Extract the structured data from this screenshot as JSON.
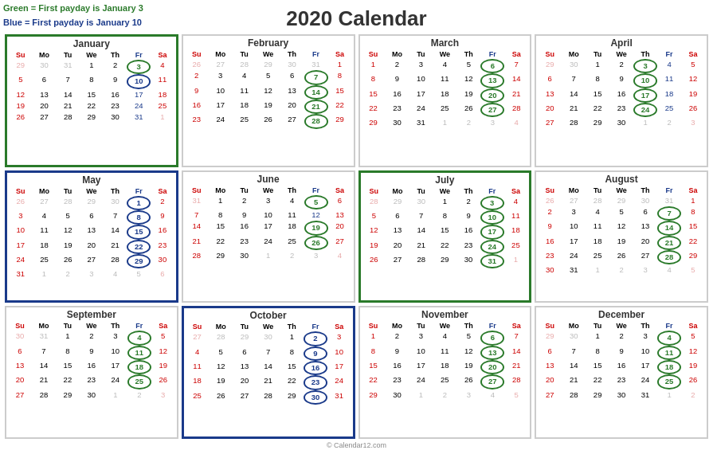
{
  "title": "2020 Calendar",
  "legend": {
    "green_text": "Green = First payday is January 3",
    "blue_text": "Blue = First payday is January 10"
  },
  "copyright": "© Calendar12.com",
  "day_headers": [
    "Su",
    "Mo",
    "Tu",
    "We",
    "Th",
    "Fr",
    "Sa"
  ],
  "months": [
    {
      "name": "January",
      "border": "green",
      "weeks": [
        [
          "29",
          "30",
          "31",
          "1",
          "2",
          "3",
          "4"
        ],
        [
          "5",
          "6",
          "7",
          "8",
          "9",
          "10",
          "11"
        ],
        [
          "12",
          "13",
          "14",
          "15",
          "16",
          "17",
          "18"
        ],
        [
          "19",
          "20",
          "21",
          "22",
          "23",
          "24",
          "25"
        ],
        [
          "26",
          "27",
          "28",
          "29",
          "30",
          "31",
          "1"
        ]
      ],
      "other_start": [
        0,
        1,
        2
      ],
      "other_end": [
        6
      ],
      "circled_green": [
        "3"
      ],
      "circled_blue": [
        "10"
      ],
      "highlighted_green": [
        "17",
        "24",
        "31"
      ]
    },
    {
      "name": "February",
      "border": "none",
      "weeks": [
        [
          "26",
          "27",
          "28",
          "29",
          "30",
          "31",
          "1"
        ],
        [
          "2",
          "3",
          "4",
          "5",
          "6",
          "7",
          "8"
        ],
        [
          "9",
          "10",
          "11",
          "12",
          "13",
          "14",
          "15"
        ],
        [
          "16",
          "17",
          "18",
          "19",
          "20",
          "21",
          "22"
        ],
        [
          "23",
          "24",
          "25",
          "26",
          "27",
          "28",
          "29"
        ]
      ],
      "other_start_w0": [
        0,
        1,
        2,
        3,
        4,
        5
      ],
      "circled_green": [
        "7",
        "14",
        "21",
        "28"
      ],
      "circled_blue": []
    },
    {
      "name": "March",
      "border": "none",
      "weeks": [
        [
          "1",
          "2",
          "3",
          "4",
          "5",
          "6",
          "7"
        ],
        [
          "8",
          "9",
          "10",
          "11",
          "12",
          "13",
          "14"
        ],
        [
          "15",
          "16",
          "17",
          "18",
          "19",
          "20",
          "21"
        ],
        [
          "22",
          "23",
          "24",
          "25",
          "26",
          "27",
          "28"
        ],
        [
          "29",
          "30",
          "31",
          "1",
          "2",
          "3",
          "4"
        ]
      ],
      "other_end_w4": [
        3,
        4,
        5,
        6
      ],
      "circled_green": [
        "6",
        "13",
        "20",
        "27"
      ],
      "circled_blue": []
    },
    {
      "name": "April",
      "border": "none",
      "weeks": [
        [
          "29",
          "30",
          "1",
          "2",
          "3",
          "4",
          "5"
        ],
        [
          "6",
          "7",
          "8",
          "9",
          "10",
          "11",
          "12"
        ],
        [
          "13",
          "14",
          "15",
          "16",
          "17",
          "18",
          "19"
        ],
        [
          "20",
          "21",
          "22",
          "23",
          "24",
          "25",
          "26"
        ],
        [
          "27",
          "28",
          "29",
          "30",
          "1",
          "2",
          "3"
        ]
      ],
      "other_start_w0": [
        0,
        1
      ],
      "other_end_w4": [
        4,
        5,
        6
      ],
      "circled_green": [
        "3",
        "10",
        "17",
        "24"
      ],
      "circled_blue": []
    },
    {
      "name": "May",
      "border": "blue",
      "weeks": [
        [
          "26",
          "27",
          "28",
          "29",
          "30",
          "1",
          "2"
        ],
        [
          "3",
          "4",
          "5",
          "6",
          "7",
          "8",
          "9"
        ],
        [
          "10",
          "11",
          "12",
          "13",
          "14",
          "15",
          "16"
        ],
        [
          "17",
          "18",
          "19",
          "20",
          "21",
          "22",
          "23"
        ],
        [
          "24",
          "25",
          "26",
          "27",
          "28",
          "29",
          "30"
        ],
        [
          "31",
          "1",
          "2",
          "3",
          "4",
          "5",
          "6"
        ]
      ],
      "other_start_w0": [
        0,
        1,
        2,
        3,
        4
      ],
      "other_end_w5": [
        1,
        2,
        3,
        4,
        5,
        6
      ],
      "circled_blue": [
        "1",
        "8",
        "15",
        "22",
        "29"
      ],
      "circled_green": []
    },
    {
      "name": "June",
      "border": "none",
      "weeks": [
        [
          "31",
          "1",
          "2",
          "3",
          "4",
          "5",
          "6"
        ],
        [
          "7",
          "8",
          "9",
          "10",
          "11",
          "12",
          "13"
        ],
        [
          "14",
          "15",
          "16",
          "17",
          "18",
          "19",
          "20"
        ],
        [
          "21",
          "22",
          "23",
          "24",
          "25",
          "26",
          "27"
        ],
        [
          "28",
          "29",
          "30",
          "1",
          "2",
          "3",
          "4"
        ]
      ],
      "other_start_w0": [
        0
      ],
      "other_end_w4": [
        3,
        4,
        5,
        6
      ],
      "circled_green": [
        "5",
        "19",
        "26"
      ],
      "circled_blue": []
    },
    {
      "name": "July",
      "border": "green",
      "weeks": [
        [
          "28",
          "29",
          "30",
          "1",
          "2",
          "3",
          "4"
        ],
        [
          "5",
          "6",
          "7",
          "8",
          "9",
          "10",
          "11"
        ],
        [
          "12",
          "13",
          "14",
          "15",
          "16",
          "17",
          "18"
        ],
        [
          "19",
          "20",
          "21",
          "22",
          "23",
          "24",
          "25"
        ],
        [
          "26",
          "27",
          "28",
          "29",
          "30",
          "31",
          "1"
        ]
      ],
      "other_start_w0": [
        0,
        1,
        2
      ],
      "other_end_w4": [
        6
      ],
      "circled_green": [
        "3",
        "10",
        "17",
        "24",
        "31"
      ],
      "circled_blue": []
    },
    {
      "name": "August",
      "border": "none",
      "weeks": [
        [
          "26",
          "27",
          "28",
          "29",
          "30",
          "31",
          "1"
        ],
        [
          "2",
          "3",
          "4",
          "5",
          "6",
          "7",
          "8"
        ],
        [
          "9",
          "10",
          "11",
          "12",
          "13",
          "14",
          "15"
        ],
        [
          "16",
          "17",
          "18",
          "19",
          "20",
          "21",
          "22"
        ],
        [
          "23",
          "24",
          "25",
          "26",
          "27",
          "28",
          "29"
        ],
        [
          "30",
          "31",
          "1",
          "2",
          "3",
          "4",
          "5"
        ]
      ],
      "other_start_w0": [
        0,
        1,
        2,
        3,
        4,
        5
      ],
      "other_end_w5": [
        2,
        3,
        4,
        5,
        6
      ],
      "circled_green": [
        "7",
        "14",
        "21",
        "28"
      ],
      "circled_blue": []
    },
    {
      "name": "September",
      "border": "none",
      "weeks": [
        [
          "30",
          "31",
          "1",
          "2",
          "3",
          "4",
          "5"
        ],
        [
          "6",
          "7",
          "8",
          "9",
          "10",
          "11",
          "12"
        ],
        [
          "13",
          "14",
          "15",
          "16",
          "17",
          "18",
          "19"
        ],
        [
          "20",
          "21",
          "22",
          "23",
          "24",
          "25",
          "26"
        ],
        [
          "27",
          "28",
          "29",
          "30",
          "1",
          "2",
          "3"
        ]
      ],
      "other_start_w0": [
        0,
        1
      ],
      "other_end_w4": [
        4,
        5,
        6
      ],
      "circled_green": [
        "4",
        "11",
        "18",
        "25"
      ],
      "circled_blue": []
    },
    {
      "name": "October",
      "border": "blue",
      "weeks": [
        [
          "27",
          "28",
          "29",
          "30",
          "1",
          "2",
          "3"
        ],
        [
          "4",
          "5",
          "6",
          "7",
          "8",
          "9",
          "10"
        ],
        [
          "11",
          "12",
          "13",
          "14",
          "15",
          "16",
          "17"
        ],
        [
          "18",
          "19",
          "20",
          "21",
          "22",
          "23",
          "24"
        ],
        [
          "25",
          "26",
          "27",
          "28",
          "29",
          "30",
          "31"
        ]
      ],
      "other_start_w0": [
        0,
        1,
        2,
        3
      ],
      "circled_blue": [
        "2",
        "9",
        "16",
        "23",
        "30"
      ],
      "circled_green": []
    },
    {
      "name": "November",
      "border": "none",
      "weeks": [
        [
          "1",
          "2",
          "3",
          "4",
          "5",
          "6",
          "7"
        ],
        [
          "8",
          "9",
          "10",
          "11",
          "12",
          "13",
          "14"
        ],
        [
          "15",
          "16",
          "17",
          "18",
          "19",
          "20",
          "21"
        ],
        [
          "22",
          "23",
          "24",
          "25",
          "26",
          "27",
          "28"
        ],
        [
          "29",
          "30",
          "1",
          "2",
          "3",
          "4",
          "5"
        ]
      ],
      "other_end_w4": [
        2,
        3,
        4,
        5,
        6
      ],
      "circled_green": [
        "6",
        "13",
        "20",
        "27"
      ],
      "circled_blue": []
    },
    {
      "name": "December",
      "border": "none",
      "weeks": [
        [
          "29",
          "30",
          "1",
          "2",
          "3",
          "4",
          "5"
        ],
        [
          "6",
          "7",
          "8",
          "9",
          "10",
          "11",
          "12"
        ],
        [
          "13",
          "14",
          "15",
          "16",
          "17",
          "18",
          "19"
        ],
        [
          "20",
          "21",
          "22",
          "23",
          "24",
          "25",
          "26"
        ],
        [
          "27",
          "28",
          "29",
          "30",
          "31",
          "1",
          "2"
        ]
      ],
      "other_start_w0": [
        0,
        1
      ],
      "other_end_w4": [
        5,
        6
      ],
      "circled_green": [
        "4",
        "11",
        "18",
        "25"
      ],
      "circled_blue": []
    }
  ]
}
